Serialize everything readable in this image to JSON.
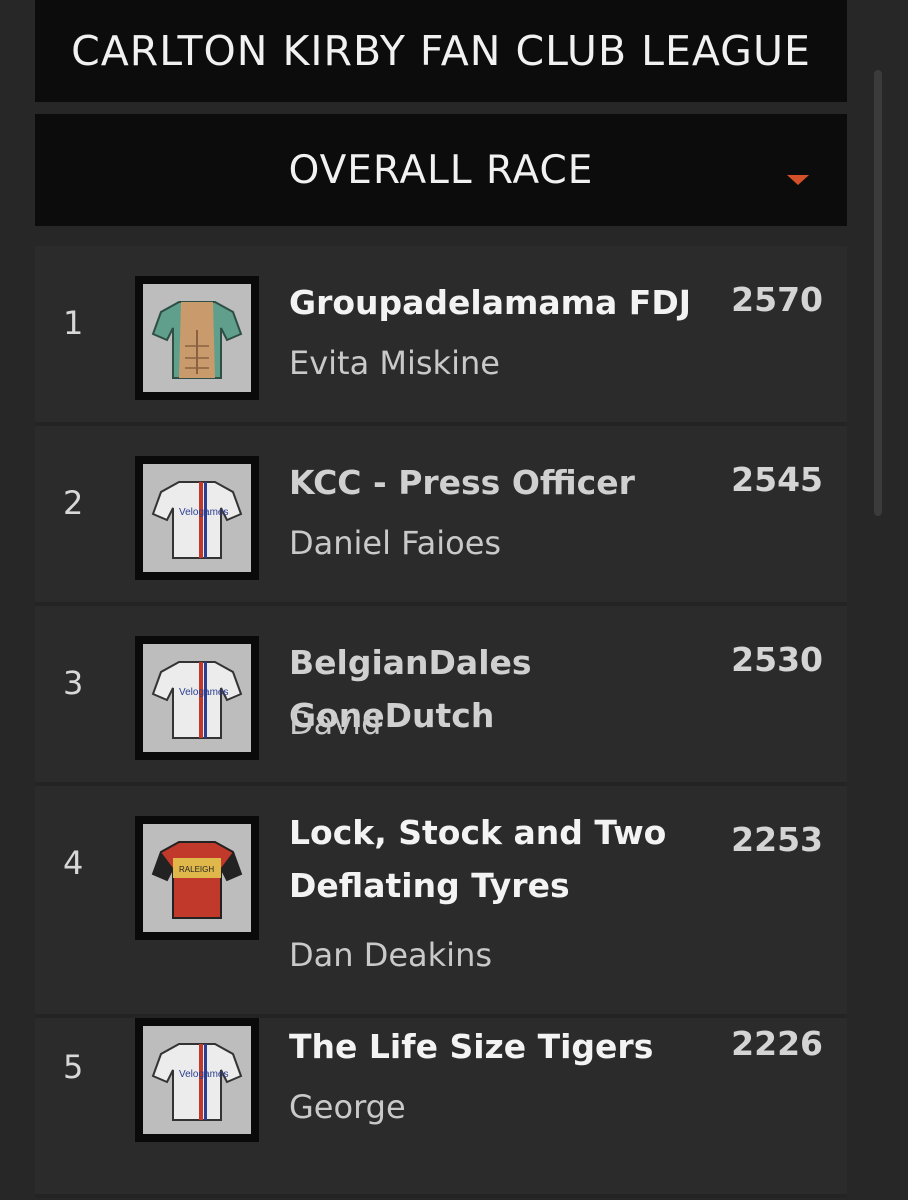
{
  "header": {
    "title": "CARLTON KIRBY FAN CLUB LEAGUE"
  },
  "race_select": {
    "selected": "OVERALL RACE",
    "icon": "caret-down-icon",
    "accent": "#d4502b"
  },
  "standings": [
    {
      "rank": "1",
      "team": "Groupadelamama FDJ",
      "manager": "Evita Miskine",
      "points": "2570",
      "jersey": "muscle-jersey-icon"
    },
    {
      "rank": "2",
      "team": "KCC - Press Officer",
      "manager": "Daniel Faioes",
      "points": "2545",
      "jersey": "velogames-jersey-icon"
    },
    {
      "rank": "3",
      "team": "BelgianDales GoneDutch",
      "manager": "David",
      "points": "2530",
      "jersey": "velogames-jersey-icon"
    },
    {
      "rank": "4",
      "team": "Lock, Stock and Two Deflating Tyres",
      "manager": "Dan Deakins",
      "points": "2253",
      "jersey": "raleigh-jersey-icon"
    },
    {
      "rank": "5",
      "team": "The Life Size Tigers",
      "manager": "George",
      "points": "2226",
      "jersey": "velogames-jersey-icon"
    }
  ],
  "jersey_text": {
    "velogames": "Velogames",
    "raleigh": "RALEIGH"
  }
}
